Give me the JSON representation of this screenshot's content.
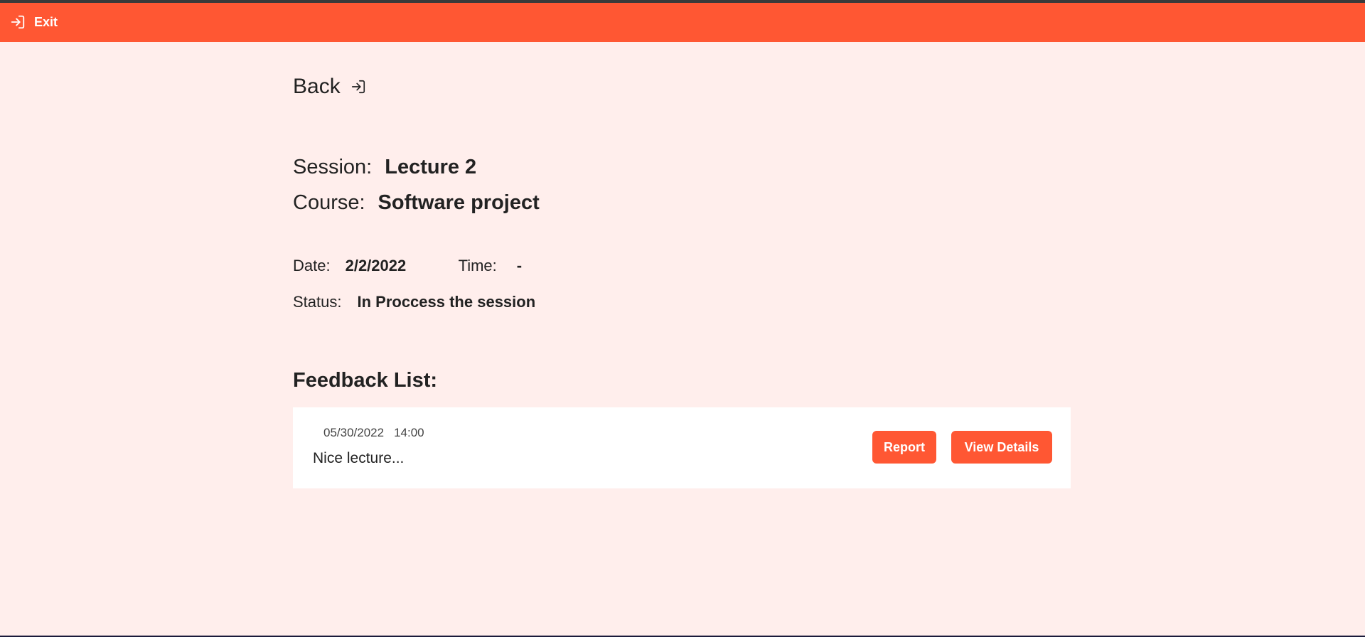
{
  "header": {
    "exit_label": "Exit",
    "exit_icon": "sign-in-icon"
  },
  "nav": {
    "back_label": "Back",
    "back_icon": "sign-in-icon"
  },
  "session": {
    "session_label": "Session:",
    "session_value": "Lecture 2",
    "course_label": "Course:",
    "course_value": "Software project",
    "date_label": "Date:",
    "date_value": "2/2/2022",
    "time_label": "Time:",
    "time_value": "-",
    "status_label": "Status:",
    "status_value": "In Proccess the session"
  },
  "feedback": {
    "title": "Feedback List:",
    "items": [
      {
        "date": "05/30/2022",
        "time": "14:00",
        "text": "Nice lecture...",
        "report_label": "Report",
        "details_label": "View Details"
      }
    ]
  },
  "colors": {
    "accent": "#ff5733",
    "background": "#ffeeec",
    "card": "#ffffff",
    "text": "#222222"
  }
}
